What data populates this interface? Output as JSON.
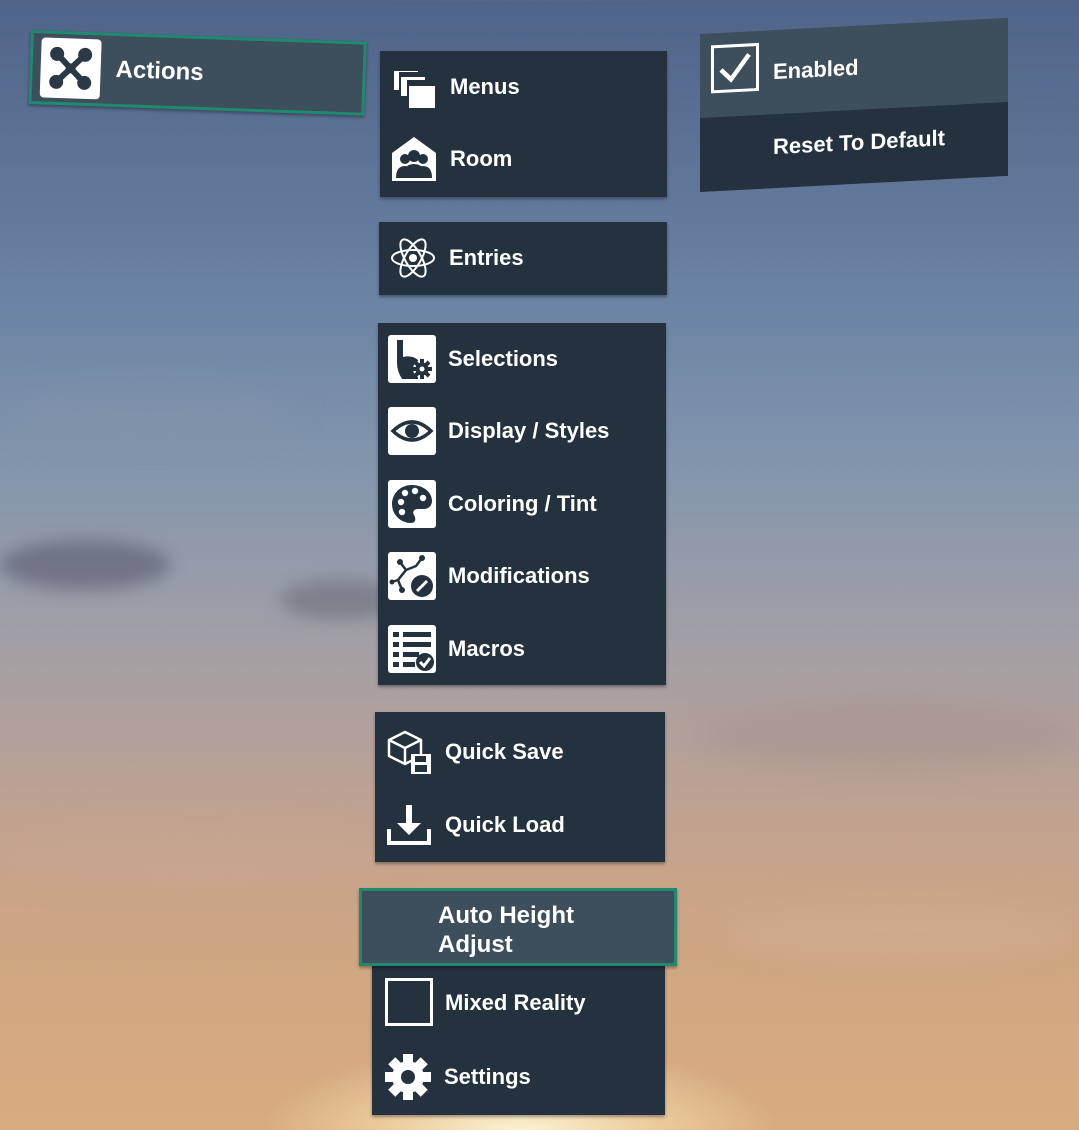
{
  "top_panel": {
    "actions_label": "Actions",
    "actions_icon": "network-nodes-icon",
    "highlight_color": "#1f8a70"
  },
  "nav_group_1": [
    {
      "label": "Menus",
      "icon": "windows-stack-icon"
    },
    {
      "label": "Room",
      "icon": "room-people-icon"
    }
  ],
  "nav_group_2": [
    {
      "label": "Entries",
      "icon": "atom-icon"
    }
  ],
  "nav_group_3": [
    {
      "label": "Selections",
      "icon": "hand-pointer-gear-icon"
    },
    {
      "label": "Display / Styles",
      "icon": "eye-icon"
    },
    {
      "label": "Coloring / Tint",
      "icon": "palette-icon"
    },
    {
      "label": "Modifications",
      "icon": "molecule-edit-icon"
    },
    {
      "label": "Macros",
      "icon": "checklist-icon"
    }
  ],
  "nav_group_4": [
    {
      "label": "Quick Save",
      "icon": "cube-save-icon"
    },
    {
      "label": "Quick Load",
      "icon": "download-icon"
    }
  ],
  "nav_group_5": {
    "auto_height_line1": "Auto Height",
    "auto_height_line2": "Adjust",
    "mixed_reality_label": "Mixed Reality",
    "mixed_reality_checked": false,
    "settings_label": "Settings",
    "settings_icon": "gear-icon"
  },
  "options_panel": {
    "enabled_label": "Enabled",
    "enabled_checked": true,
    "reset_label": "Reset To Default"
  }
}
